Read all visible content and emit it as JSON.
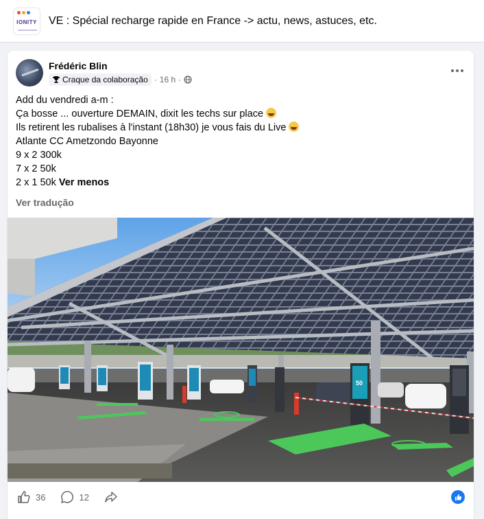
{
  "group": {
    "title": "VE : Spécial recharge rapide en France -> actu, news, astuces, etc.",
    "logo_text": "IONITY"
  },
  "post": {
    "author": "Frédéric Blin",
    "badge": "Craque da colaboração",
    "time": "16 h",
    "separator": "·",
    "lines": [
      "Add du vendredi a-m :",
      "Ça bosse ... ouverture DEMAIN, dixit les techs sur place",
      "Ils retirent les rubalises à l'instant (18h30) je vous fais du Live",
      "Atlante CC Ametzondo Bayonne",
      "9 x 2  300k",
      "7 x 2  50k",
      "2 x 1  50k"
    ],
    "see_less": "Ver menos",
    "translate": "Ver tradução",
    "photo_charger_label": "50"
  },
  "actions": {
    "likes": "36",
    "comments": "12"
  },
  "colors": {
    "accent": "#1877f2",
    "secondary_text": "#65676b",
    "parking_green": "#4cc85a"
  },
  "icons": [
    "more-icon",
    "trophy-icon",
    "globe-icon",
    "like-icon",
    "comment-icon",
    "share-icon",
    "like-badge-icon"
  ]
}
